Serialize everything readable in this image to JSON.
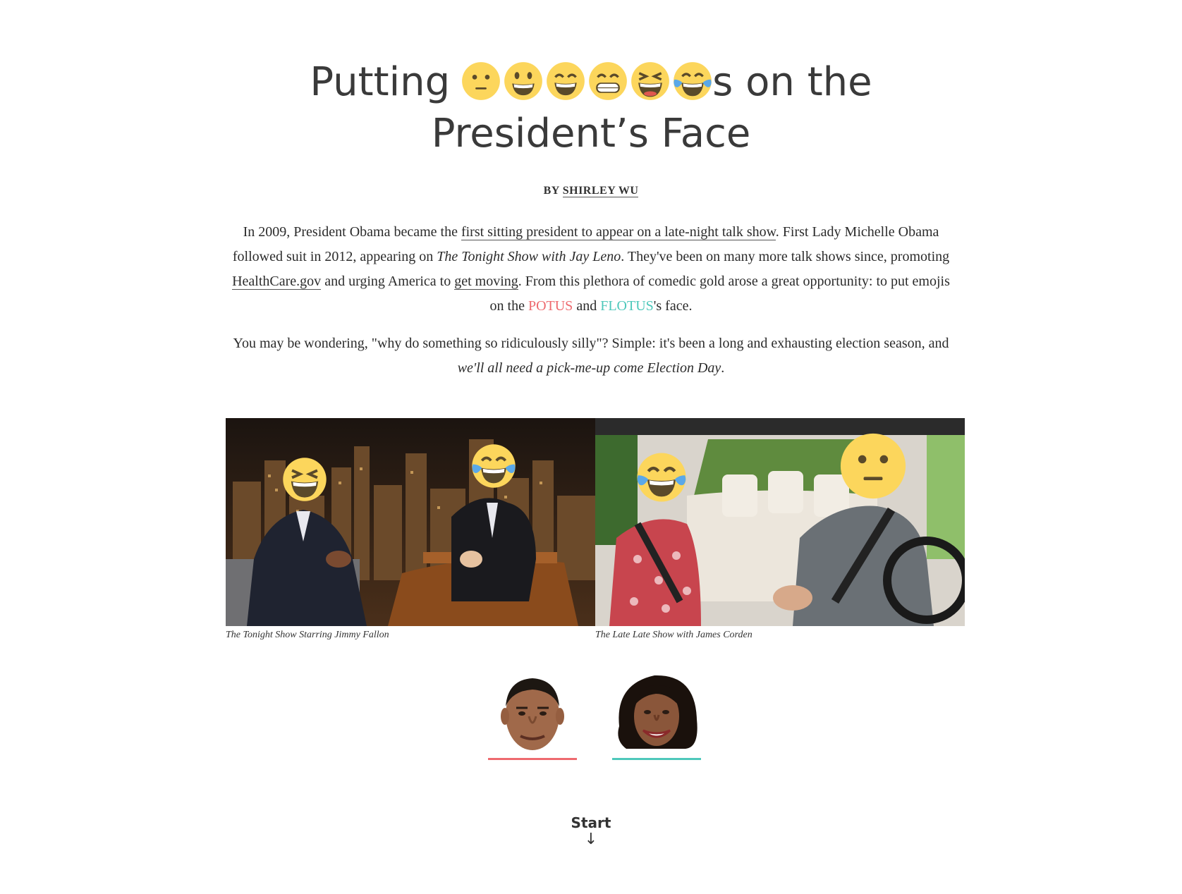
{
  "title": {
    "line1_prefix": "Putting",
    "line1_suffix": "s on the",
    "line2": "President’s Face",
    "emoji_icons": [
      "neutral-face-icon",
      "grinning-face-icon",
      "smiling-face-icon",
      "grimacing-face-icon",
      "laughing-face-icon",
      "tears-of-joy-icon"
    ]
  },
  "byline": {
    "prefix": "BY",
    "author": "SHIRLEY WU"
  },
  "intro": {
    "p1": {
      "t1": "In 2009, President Obama became the ",
      "link1": "first sitting president to appear on a late-night talk show",
      "t2": ". First Lady Michelle Obama followed suit in 2012, appearing on ",
      "show": "The Tonight Show with Jay Leno",
      "t3": ". They've been on many more talk shows since, promoting ",
      "link2": "HealthCare.gov",
      "t4": " and urging America to ",
      "link3": "get moving",
      "t5": ". From this plethora of comedic gold arose a great opportunity: to put emojis on the ",
      "potus": "POTUS",
      "t6": " and ",
      "flotus": "FLOTUS",
      "t7": "'s face."
    },
    "p2": {
      "t1": "You may be wondering, \"why do something so ridiculously silly\"? Simple: it's been a long and exhausting election season, and ",
      "emph": "we'll all need a pick-me-up come Election Day",
      "t2": "."
    }
  },
  "photos": {
    "left_caption": "The Tonight Show Starring Jimmy Fallon",
    "right_caption": "The Late Late Show with James Corden"
  },
  "colors": {
    "potus": "#ee6a6f",
    "flotus": "#4ec8bb",
    "emoji_yellow": "#fcd65c"
  },
  "start": {
    "label": "Start",
    "arrow": "↓"
  }
}
